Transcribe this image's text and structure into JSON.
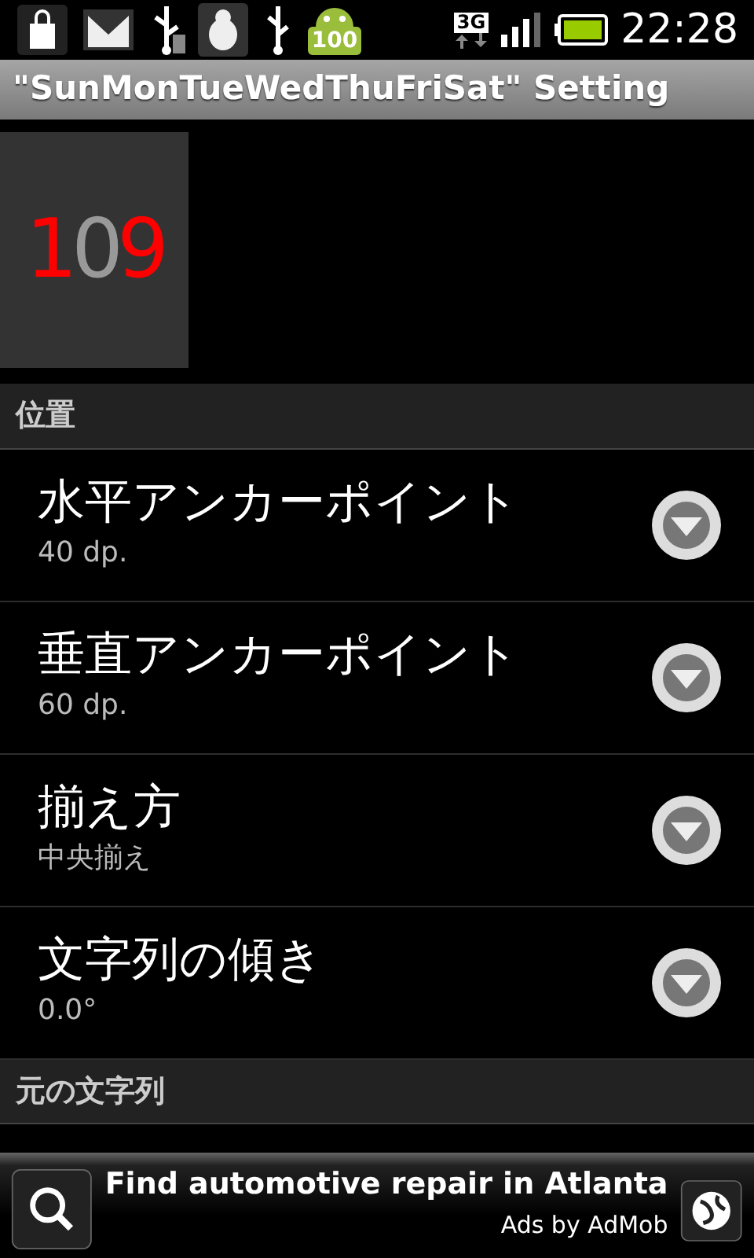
{
  "status_bar": {
    "network": "3G",
    "battery_badge": "100",
    "time": "22:28"
  },
  "title": "\"SunMonTueWedThuFriSat\" Setting",
  "preview": {
    "digits": [
      {
        "text": "1",
        "color": "#ff0000"
      },
      {
        "text": "0",
        "color": "#999999"
      },
      {
        "text": "9",
        "color": "#ff0000"
      }
    ]
  },
  "sections": [
    {
      "header": "位置",
      "items": [
        {
          "title": "水平アンカーポイント",
          "value": "40 dp."
        },
        {
          "title": "垂直アンカーポイント",
          "value": "60 dp."
        },
        {
          "title": "揃え方",
          "value": "中央揃え"
        },
        {
          "title": "文字列の傾き",
          "value": "0.0°"
        }
      ]
    },
    {
      "header": "元の文字列"
    }
  ],
  "ad": {
    "headline": "Find automotive repair in Atlanta",
    "attribution": "Ads by AdMob"
  }
}
